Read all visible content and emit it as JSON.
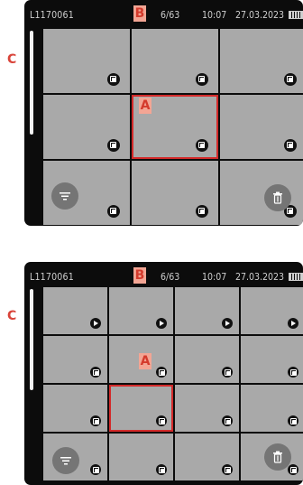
{
  "screens": [
    {
      "status": {
        "filename": "L1170061",
        "count": "6/63",
        "time": "10:07",
        "date": "27.03.2023"
      },
      "thumb_icons": [
        "stack",
        "stack",
        "stack",
        "stack",
        "stack",
        "stack",
        "stack",
        "stack",
        "stack"
      ],
      "selected_index": 4,
      "callouts": {
        "a": "A",
        "b": "B",
        "c": "C"
      }
    },
    {
      "status": {
        "filename": "L1170061",
        "count": "6/63",
        "time": "10:07",
        "date": "27.03.2023"
      },
      "thumb_icons": [
        "play",
        "play",
        "play",
        "play",
        "stack",
        "stack",
        "stack",
        "stack",
        "stack",
        "stack",
        "stack",
        "stack",
        "stack",
        "stack",
        "stack",
        "stack"
      ],
      "selected_index": 9,
      "callouts": {
        "a": "A",
        "b": "B",
        "c": "C"
      }
    }
  ],
  "icons": [
    "filter-icon",
    "trash-icon",
    "stack-icon",
    "play-icon",
    "battery-icon"
  ],
  "colors": {
    "highlight": "#d42a2a",
    "callout_bg": "#f3a594",
    "callout_text": "#d43a2c",
    "thumb": "#a9a9a9"
  }
}
